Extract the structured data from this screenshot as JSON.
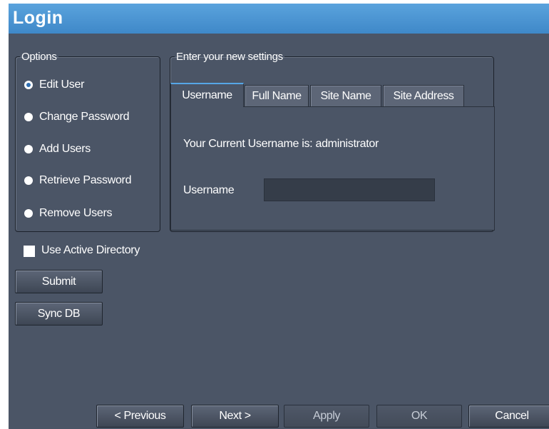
{
  "window": {
    "title": "Login"
  },
  "options": {
    "legend": "Options",
    "items": [
      {
        "label": "Edit User",
        "checked": true
      },
      {
        "label": "Change Password",
        "checked": false
      },
      {
        "label": "Add Users",
        "checked": false
      },
      {
        "label": "Retrieve Password",
        "checked": false
      },
      {
        "label": "Remove Users",
        "checked": false
      }
    ]
  },
  "active_directory": {
    "label": "Use Active Directory",
    "checked": false
  },
  "actions": {
    "submit": "Submit",
    "sync_db": "Sync DB"
  },
  "settings": {
    "legend": "Enter your new settings",
    "tabs": [
      {
        "label": "Username",
        "active": true
      },
      {
        "label": "Full Name",
        "active": false
      },
      {
        "label": "Site Name",
        "active": false
      },
      {
        "label": "Site Address",
        "active": false
      }
    ],
    "current_username_text": "Your Current Username is: administrator",
    "username_label": "Username",
    "username_value": ""
  },
  "footer": {
    "previous": "< Previous",
    "next": "Next >",
    "apply": "Apply",
    "ok": "OK",
    "cancel": "Cancel"
  },
  "colors": {
    "title_bar": "#4b95d3",
    "window_bg": "#4b5566",
    "active_tab_accent": "#56a6e6"
  }
}
